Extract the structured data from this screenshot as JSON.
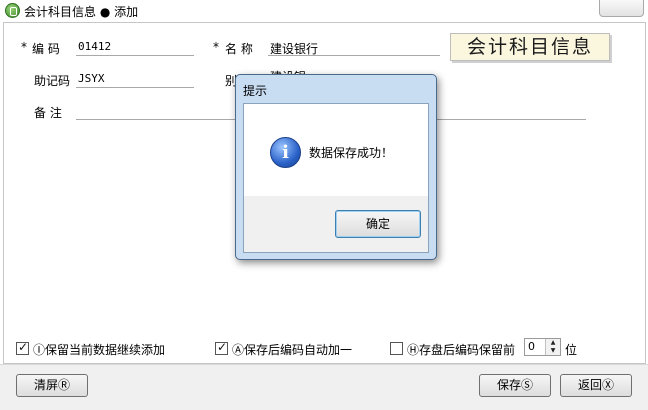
{
  "window": {
    "title": "会计科目信息 ● 添加"
  },
  "form": {
    "required_mark": "*",
    "code": {
      "label": "编  码",
      "value": "01412"
    },
    "name": {
      "label": "名  称",
      "value": "建设银行"
    },
    "mnemonic": {
      "label": "助记码",
      "value": "JSYX"
    },
    "alias": {
      "label": "别",
      "value": "建设银"
    },
    "remark": {
      "label": "备  注",
      "value": ""
    },
    "logo": "会计科目信息"
  },
  "options": {
    "keep_data": {
      "label": "Ⓘ保留当前数据继续添加",
      "checked": true
    },
    "auto_increment": {
      "label": "Ⓐ保存后编码自动加一",
      "checked": true
    },
    "keep_prefix": {
      "label": "Ⓗ存盘后编码保留前",
      "checked": false,
      "value": "0",
      "suffix": "位"
    }
  },
  "buttons": {
    "clear": "清屏Ⓡ",
    "save": "保存Ⓢ",
    "back": "返回Ⓧ"
  },
  "dialog": {
    "title": "提示",
    "message": "数据保存成功！",
    "ok": "确定",
    "icon": "info-icon"
  }
}
